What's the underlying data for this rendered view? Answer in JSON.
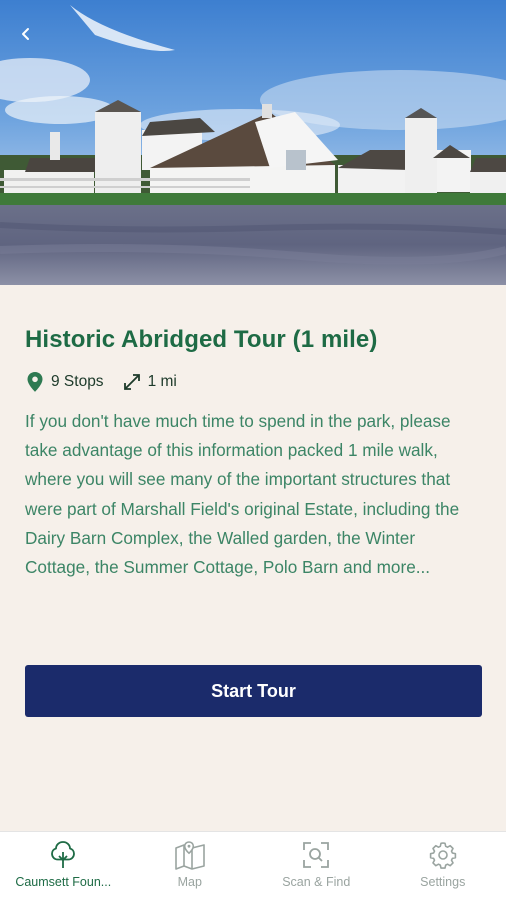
{
  "header": {
    "back_icon": "chevron-left-icon"
  },
  "tour": {
    "title": "Historic Abridged Tour (1 mile)",
    "stops": "9 Stops",
    "distance": "1 mi",
    "description": "If you don't have much time to spend in the park, please take advantage of this information packed 1 mile walk, where you will see many of the important structures that were part of Marshall Field's original Estate, including the Dairy Barn Complex, the Walled garden, the Winter Cottage, the Summer Cottage, Polo Barn and more...",
    "start_label": "Start Tour"
  },
  "tabs": [
    {
      "label": "Caumsett Foun...",
      "icon": "tree-icon",
      "active": true
    },
    {
      "label": "Map",
      "icon": "map-icon",
      "active": false
    },
    {
      "label": "Scan & Find",
      "icon": "scan-icon",
      "active": false
    },
    {
      "label": "Settings",
      "icon": "gear-icon",
      "active": false
    }
  ],
  "colors": {
    "accent": "#1e6b45",
    "button": "#1b2b6b",
    "background": "#f6f0ea"
  }
}
